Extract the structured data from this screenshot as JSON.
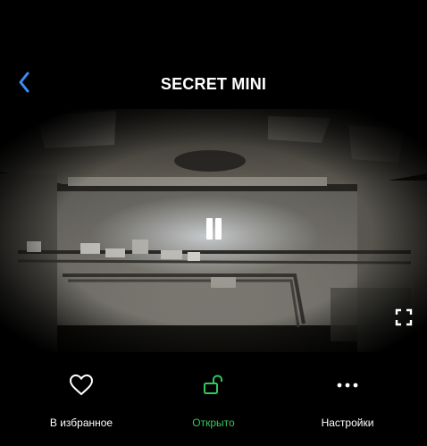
{
  "header": {
    "title": "SECRET MINI",
    "back_icon": "chevron-left-icon",
    "accent_color": "#3d8bf2"
  },
  "video": {
    "state": "playing",
    "pause_icon": "pause-icon",
    "fullscreen_icon": "fullscreen-icon"
  },
  "toolbar": {
    "actions": [
      {
        "label": "В избранное",
        "icon": "heart-icon"
      },
      {
        "label": "Открыто",
        "icon": "unlock-icon",
        "color": "#34c759"
      },
      {
        "label": "Настройки",
        "icon": "more-icon"
      }
    ]
  }
}
